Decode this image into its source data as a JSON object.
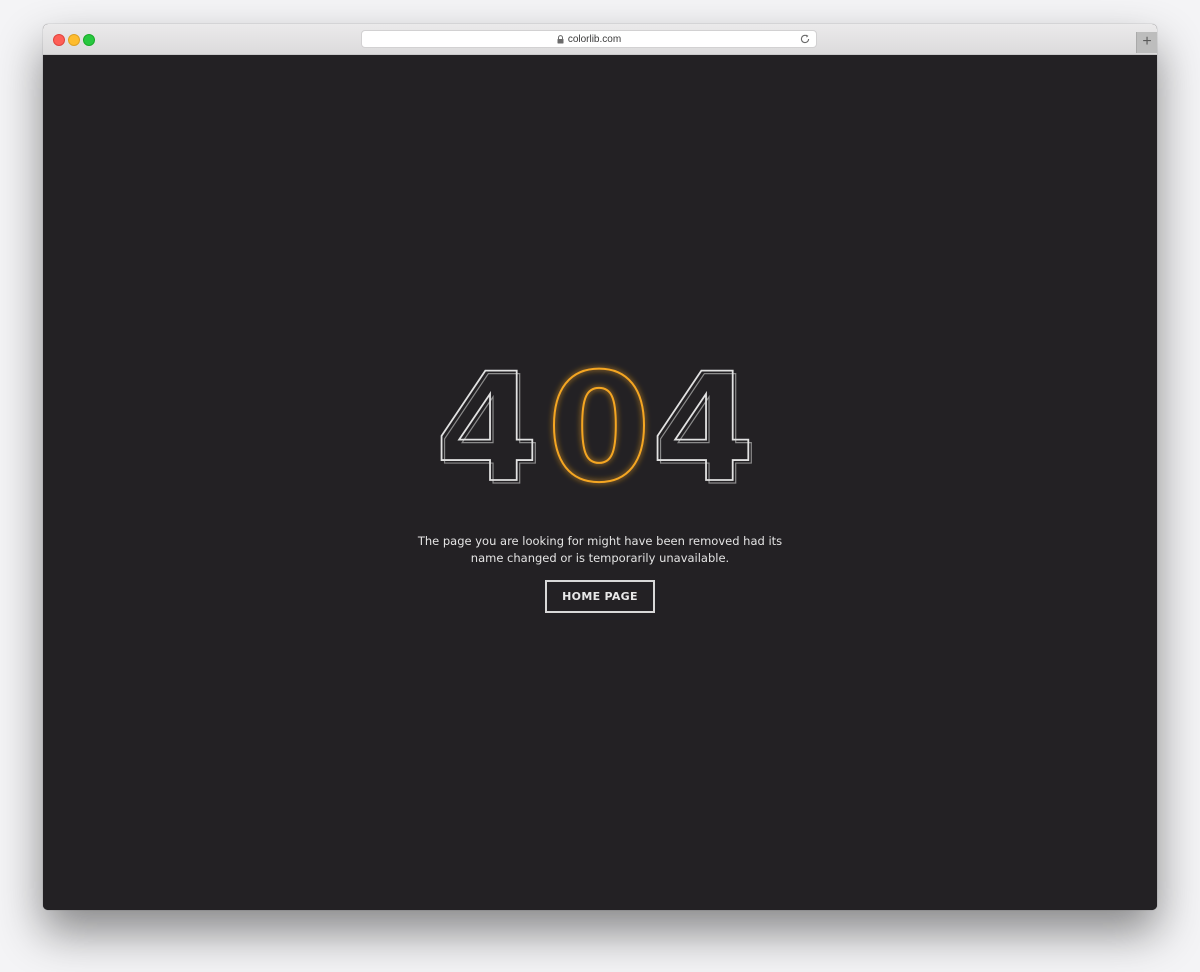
{
  "browser": {
    "url": "colorlib.com",
    "new_tab_label": "+"
  },
  "error": {
    "digit_1": "4",
    "digit_2": "0",
    "digit_3": "4",
    "message": "The page you are looking for might have been removed had its name changed or is temporarily unavailable.",
    "button_label": "HOME PAGE"
  },
  "colors": {
    "background": "#232124",
    "accent": "#f5a623",
    "outline": "#d8d8d8"
  }
}
